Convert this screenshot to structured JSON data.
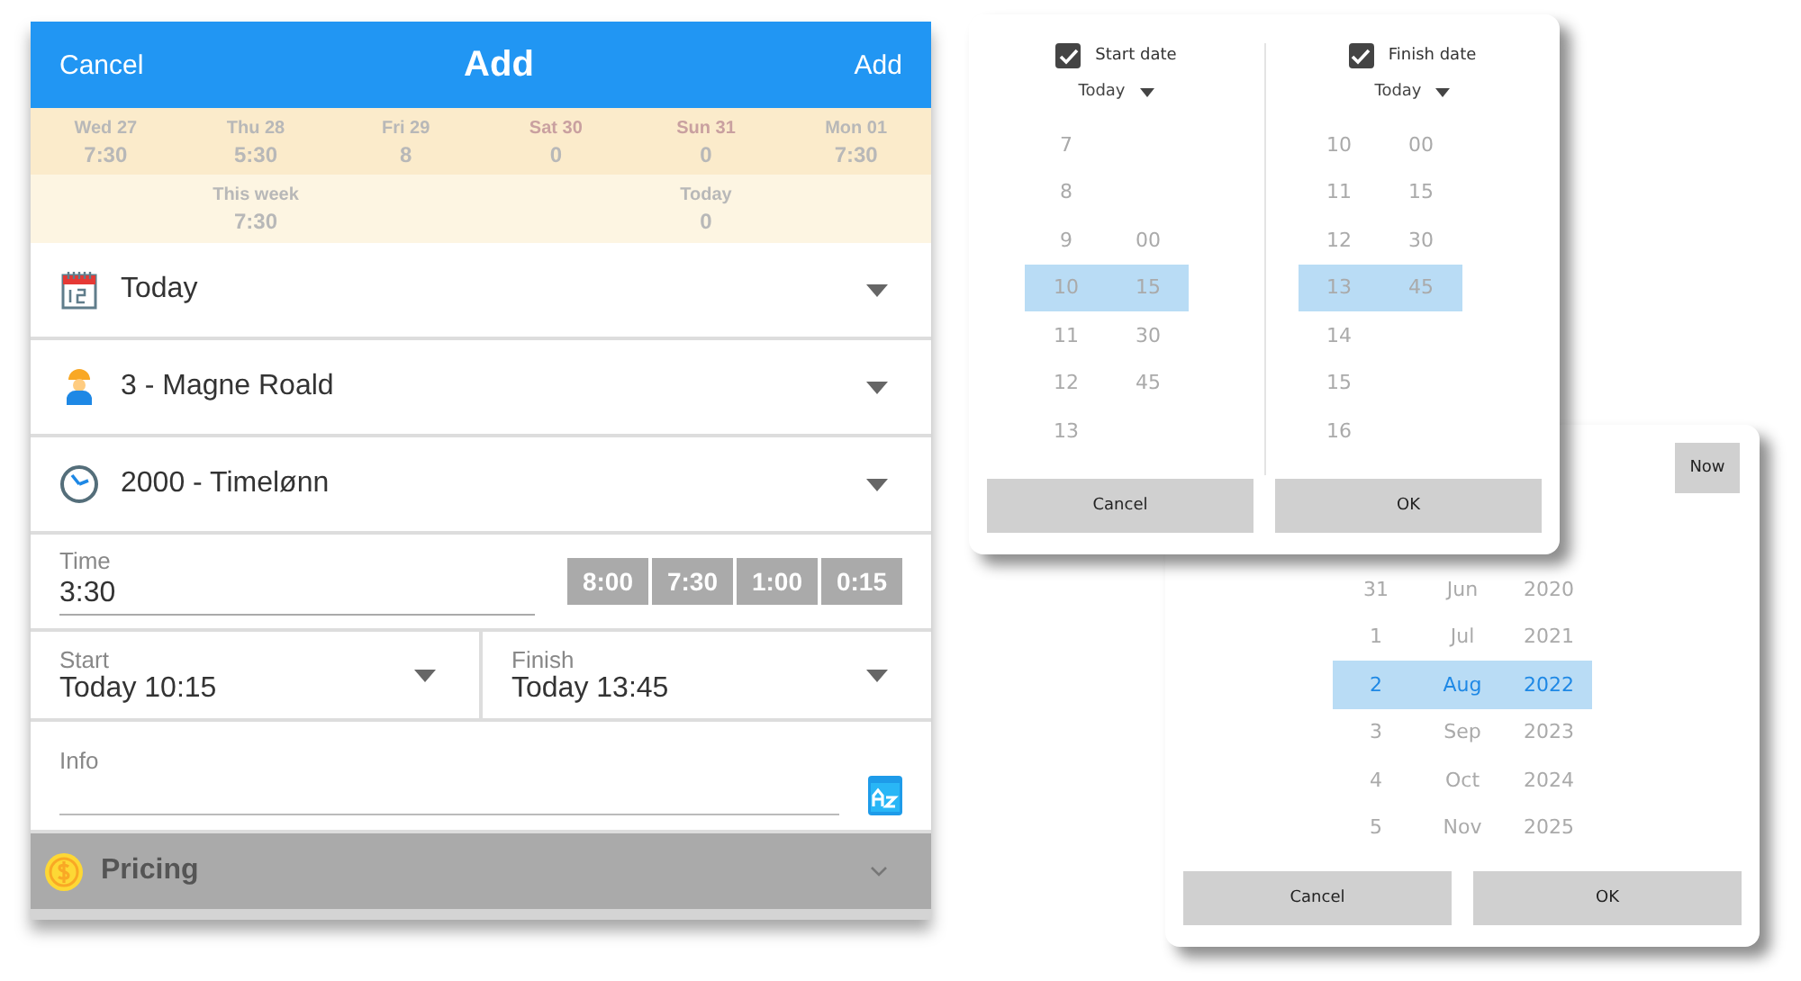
{
  "form": {
    "header": {
      "cancel": "Cancel",
      "title": "Add",
      "add": "Add"
    },
    "week_days": [
      {
        "day": "Wed 27",
        "hours": "7:30",
        "weekend": false
      },
      {
        "day": "Thu 28",
        "hours": "5:30",
        "weekend": false
      },
      {
        "day": "Fri 29",
        "hours": "8",
        "weekend": false
      },
      {
        "day": "Sat 30",
        "hours": "0",
        "weekend": true
      },
      {
        "day": "Sun 31",
        "hours": "0",
        "weekend": true
      },
      {
        "day": "Mon 01",
        "hours": "7:30",
        "weekend": false
      }
    ],
    "summary": [
      {
        "label": "This week",
        "value": "7:30"
      },
      {
        "label": "Today",
        "value": "0"
      }
    ],
    "pickers": [
      {
        "kind": "date",
        "value": "Today"
      },
      {
        "kind": "worker",
        "value": "3 - Magne Roald"
      },
      {
        "kind": "wage",
        "value": "2000 - Timelønn"
      }
    ],
    "time": {
      "label": "Time",
      "value": "3:30",
      "presets": [
        "8:00",
        "7:30",
        "1:00",
        "0:15"
      ]
    },
    "start": {
      "label": "Start",
      "value": "Today 10:15"
    },
    "finish": {
      "label": "Finish",
      "value": "Today 13:45"
    },
    "info": {
      "label": "Info"
    },
    "pricing": {
      "label": "Pricing"
    }
  },
  "date_dialog": {
    "now": "Now",
    "rows": [
      {
        "day": "31",
        "month": "Jun",
        "year": "2020",
        "selected": false
      },
      {
        "day": "1",
        "month": "Jul",
        "year": "2021",
        "selected": false
      },
      {
        "day": "2",
        "month": "Aug",
        "year": "2022",
        "selected": true
      },
      {
        "day": "3",
        "month": "Sep",
        "year": "2023",
        "selected": false
      },
      {
        "day": "4",
        "month": "Oct",
        "year": "2024",
        "selected": false
      },
      {
        "day": "5",
        "month": "Nov",
        "year": "2025",
        "selected": false
      }
    ],
    "buttons": [
      "Cancel",
      "OK"
    ]
  },
  "time_dialog": {
    "columns": [
      {
        "label": "Start date",
        "checked": true,
        "day": "Today",
        "rows": [
          {
            "hour": "7",
            "selected": false
          },
          {
            "hour": "8",
            "selected": false
          },
          {
            "hour": "9",
            "minute": "00",
            "selected": false
          },
          {
            "hour": "10",
            "minute": "15",
            "selected": true
          },
          {
            "hour": "11",
            "minute": "30",
            "selected": false
          },
          {
            "hour": "12",
            "minute": "45",
            "selected": false
          },
          {
            "hour": "13",
            "selected": false
          }
        ]
      },
      {
        "label": "Finish date",
        "checked": true,
        "day": "Today",
        "rows": [
          {
            "hour": "10",
            "minute": "00",
            "selected": false
          },
          {
            "hour": "11",
            "minute": "15",
            "selected": false
          },
          {
            "hour": "12",
            "minute": "30",
            "selected": false
          },
          {
            "hour": "13",
            "minute": "45",
            "selected": true
          },
          {
            "hour": "14",
            "selected": false
          },
          {
            "hour": "15",
            "selected": false
          },
          {
            "hour": "16",
            "selected": false
          }
        ]
      }
    ],
    "buttons": [
      "Cancel",
      "OK"
    ]
  }
}
